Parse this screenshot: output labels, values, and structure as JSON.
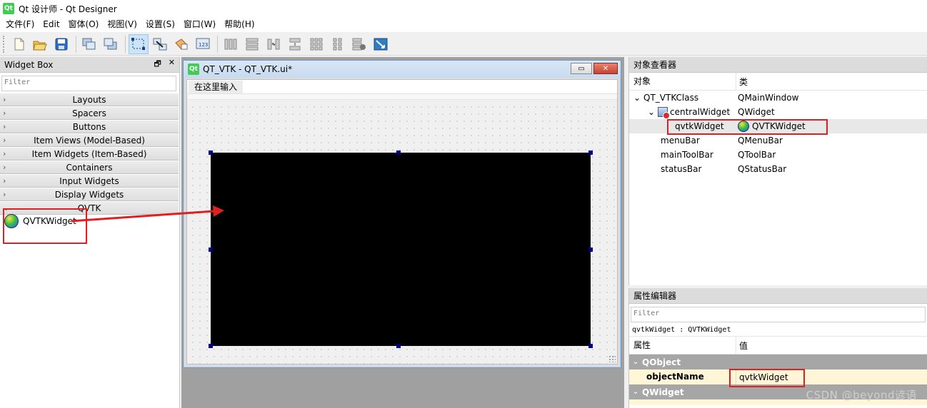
{
  "window": {
    "logo": "Qt",
    "title": "Qt 设计师 - Qt Designer"
  },
  "menubar": [
    "文件(F)",
    "Edit",
    "窗体(O)",
    "视图(V)",
    "设置(S)",
    "窗口(W)",
    "帮助(H)"
  ],
  "toolbar": {
    "groups": [
      [
        "new-form-icon",
        "open-form-icon",
        "save-form-icon"
      ],
      [
        "send-to-back-icon",
        "bring-to-front-icon"
      ],
      [
        "edit-widgets-icon",
        "edit-signals-slots-icon",
        "edit-buddies-icon",
        "edit-tab-order-icon"
      ],
      [
        "layout-horizontal-icon",
        "layout-vertical-icon",
        "layout-h-splitter-icon",
        "layout-v-splitter-icon",
        "layout-grid-icon",
        "layout-form-icon",
        "break-layout-icon",
        "adjust-size-icon"
      ]
    ],
    "active": "edit-widgets-icon"
  },
  "widget_box": {
    "title": "Widget Box",
    "filter_placeholder": "Filter",
    "categories": [
      {
        "label": "Layouts",
        "expanded": false
      },
      {
        "label": "Spacers",
        "expanded": false
      },
      {
        "label": "Buttons",
        "expanded": false
      },
      {
        "label": "Item Views (Model-Based)",
        "expanded": false
      },
      {
        "label": "Item Widgets (Item-Based)",
        "expanded": false
      },
      {
        "label": "Containers",
        "expanded": false
      },
      {
        "label": "Input Widgets",
        "expanded": false
      },
      {
        "label": "Display Widgets",
        "expanded": false
      },
      {
        "label": "QVTK",
        "expanded": true
      }
    ],
    "qvtk_item": "QVTKWidget"
  },
  "designer_window": {
    "logo": "Qt",
    "title": "QT_VTK - QT_VTK.ui*",
    "menu_placeholder": "在这里输入",
    "min_glyph": "▭",
    "close_glyph": "✕"
  },
  "object_inspector": {
    "title": "对象查看器",
    "col_object": "对象",
    "col_class": "类",
    "rows": [
      {
        "object": "QT_VTKClass",
        "class": "QMainWindow",
        "level": 0,
        "chev": "⌄"
      },
      {
        "object": "centralWidget",
        "class": "QWidget",
        "level": 1,
        "chev": "⌄"
      },
      {
        "object": "qvtkWidget",
        "class": "QVTKWidget",
        "level": 2,
        "selected": true
      },
      {
        "object": "menuBar",
        "class": "QMenuBar",
        "level": 1
      },
      {
        "object": "mainToolBar",
        "class": "QToolBar",
        "level": 1
      },
      {
        "object": "statusBar",
        "class": "QStatusBar",
        "level": 1
      }
    ]
  },
  "property_editor": {
    "title": "属性编辑器",
    "filter_placeholder": "Filter",
    "object_line": "qvtkWidget : QVTKWidget",
    "col_property": "属性",
    "col_value": "值",
    "groups": [
      {
        "label": "QObject",
        "props": [
          {
            "name": "objectName",
            "value": "qvtkWidget"
          }
        ]
      },
      {
        "label": "QWidget",
        "props": []
      }
    ]
  },
  "watermark": "CSDN @beyond谚语",
  "colors": {
    "annotation": "#e02020",
    "vtk_canvas": "#000000",
    "group_header": "#a6a6a6",
    "property_row": "#fff5d7"
  }
}
